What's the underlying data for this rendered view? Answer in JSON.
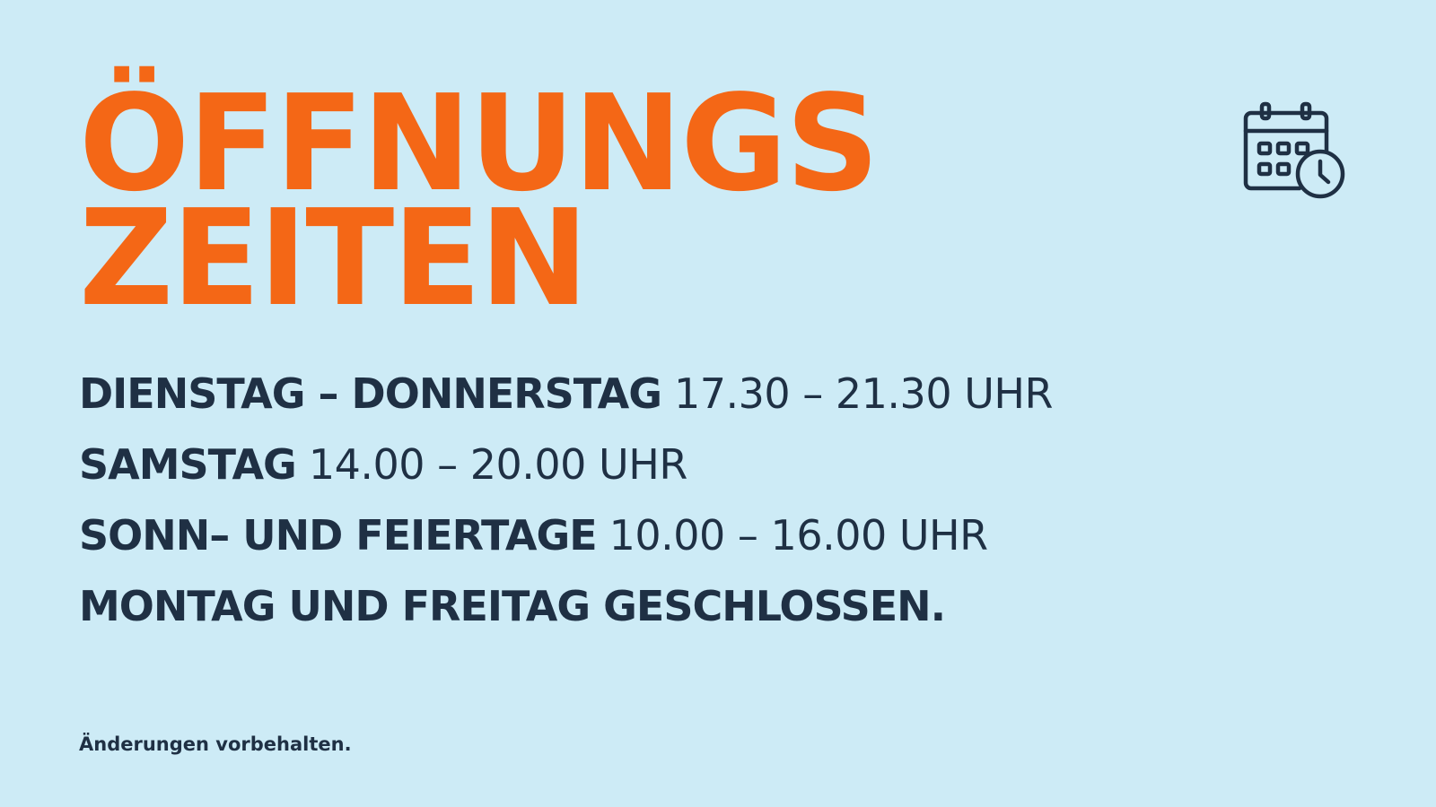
{
  "headline": {
    "line1": "ÖFFNUNGS",
    "line2": "ZEITEN"
  },
  "hours": [
    {
      "day": "DIENSTAG – DONNERSTAG",
      "time": "17.30  – 21.30 UHR"
    },
    {
      "day": "SAMSTAG",
      "time": "14.00 – 20.00 UHR"
    },
    {
      "day": "SONN– UND FEIERTAGE",
      "time": "10.00 – 16.00 UHR"
    }
  ],
  "closed": "MONTAG UND FREITAG GESCHLOSSEN.",
  "note": "Änderungen vorbehalten.",
  "icon": "calendar-clock-icon",
  "colors": {
    "background": "#cdebf6",
    "accent": "#f46716",
    "text": "#1f3044"
  }
}
